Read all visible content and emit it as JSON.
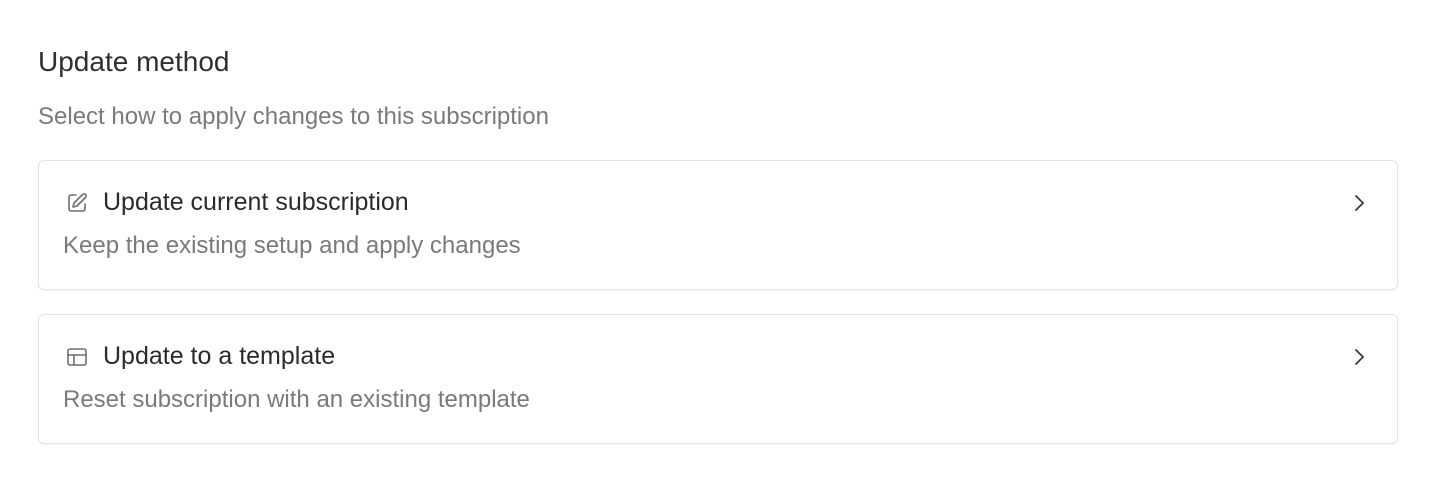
{
  "section": {
    "title": "Update method",
    "subtitle": "Select how to apply changes to this subscription"
  },
  "options": [
    {
      "title": "Update current subscription",
      "description": "Keep the existing setup and apply changes",
      "icon": "edit-icon"
    },
    {
      "title": "Update to a template",
      "description": "Reset subscription with an existing template",
      "icon": "template-layout-icon"
    }
  ],
  "colors": {
    "text_primary": "#2b2b2b",
    "text_secondary": "#7a7a7a",
    "border": "#e4e4e4"
  }
}
